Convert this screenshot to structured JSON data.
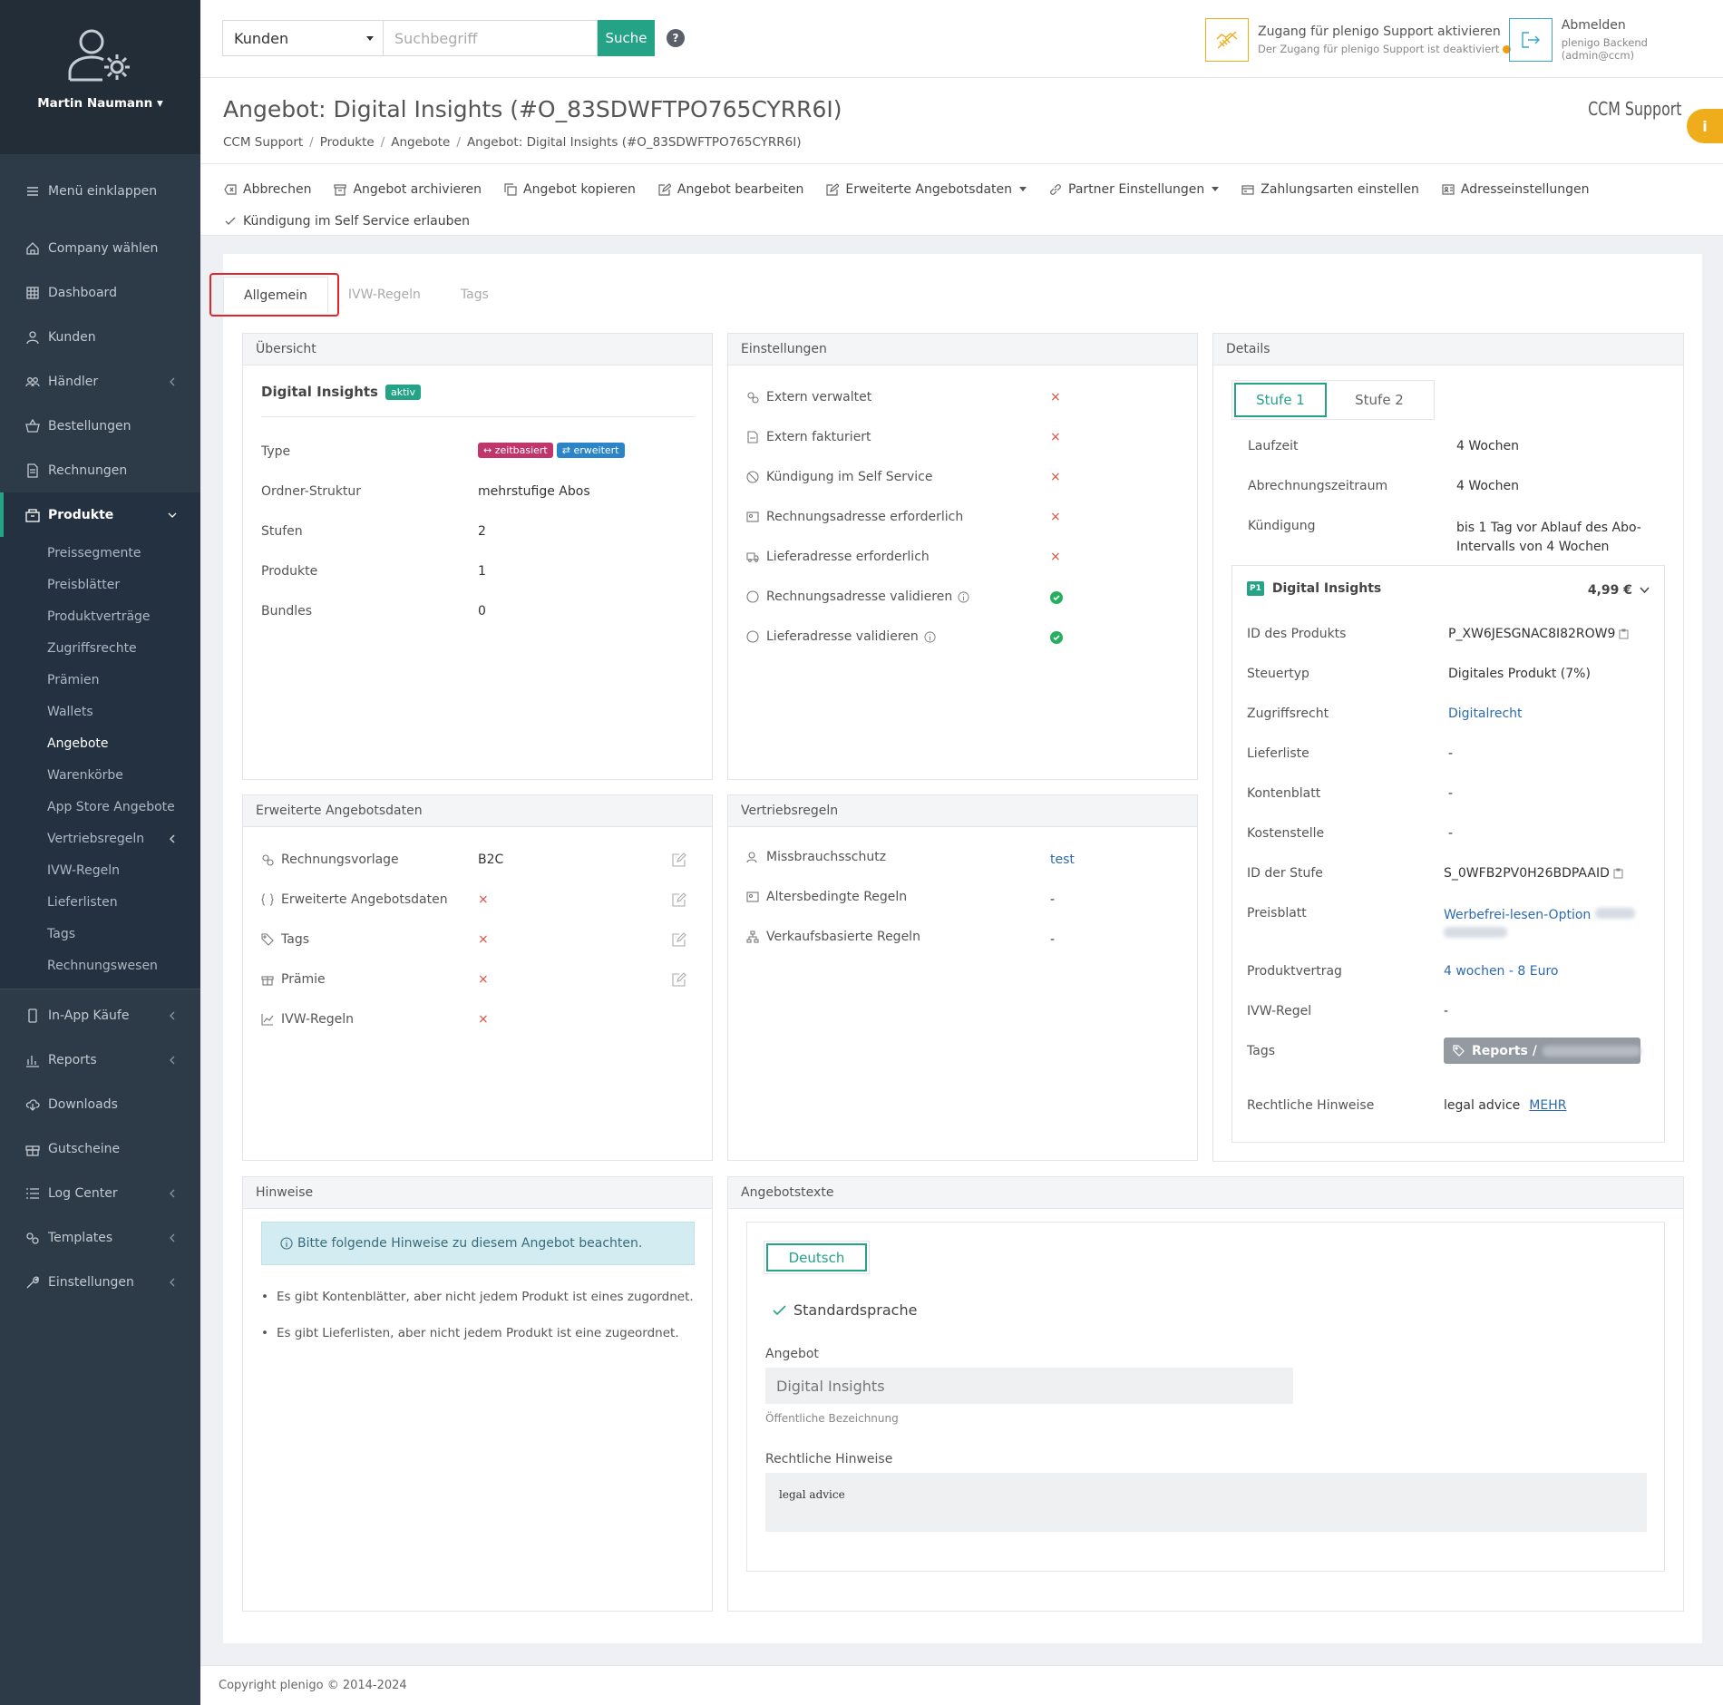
{
  "user": {
    "name": "Martin Naumann"
  },
  "sidebar": {
    "collapse": "Menü einklappen",
    "items": [
      {
        "label": "Company wählen"
      },
      {
        "label": "Dashboard"
      },
      {
        "label": "Kunden"
      },
      {
        "label": "Händler"
      },
      {
        "label": "Bestellungen"
      },
      {
        "label": "Rechnungen"
      },
      {
        "label": "Produkte"
      }
    ],
    "sub": [
      "Preissegmente",
      "Preisblätter",
      "Produktverträge",
      "Zugriffsrechte",
      "Prämien",
      "Wallets",
      "Angebote",
      "Warenkörbe",
      "App Store Angebote",
      "Vertriebsregeln",
      "IVW-Regeln",
      "Lieferlisten",
      "Tags",
      "Rechnungswesen"
    ],
    "items2": [
      {
        "label": "In-App Käufe"
      },
      {
        "label": "Reports"
      },
      {
        "label": "Downloads"
      },
      {
        "label": "Gutscheine"
      },
      {
        "label": "Log Center"
      },
      {
        "label": "Templates"
      },
      {
        "label": "Einstellungen"
      }
    ]
  },
  "topbar": {
    "select": "Kunden",
    "placeholder": "Suchbegriff",
    "search": "Suche",
    "help": "?",
    "support_title": "Zugang für plenigo Support aktivieren",
    "support_sub": "Der Zugang für plenigo Support ist deaktiviert",
    "logout_title": "Abmelden",
    "logout_sub": "plenigo Backend (admin@ccm)"
  },
  "header": {
    "title": "Angebot: Digital Insights (#O_83SDWFTPO765CYRR6I)",
    "breadcrumb": [
      "CCM Support",
      "Produkte",
      "Angebote",
      "Angebot: Digital Insights (#O_83SDWFTPO765CYRR6I)"
    ],
    "company": "CCM Support",
    "info": "i",
    "actions": [
      "Abbrechen",
      "Angebot archivieren",
      "Angebot kopieren",
      "Angebot bearbeiten",
      "Erweiterte Angebotsdaten",
      "Partner Einstellungen",
      "Zahlungsarten einstellen",
      "Adresseinstellungen",
      "Kündigung im Self Service erlauben"
    ]
  },
  "tabs": [
    "Allgemein",
    "IVW-Regeln",
    "Tags"
  ],
  "overview": {
    "title": "Übersicht",
    "name": "Digital Insights",
    "status": "aktiv",
    "type_label": "Type",
    "badge1": "zeitbasiert",
    "badge2": "erweitert",
    "rows": [
      {
        "label": "Ordner-Struktur",
        "value": "mehrstufige Abos"
      },
      {
        "label": "Stufen",
        "value": "2"
      },
      {
        "label": "Produkte",
        "value": "1"
      },
      {
        "label": "Bundles",
        "value": "0"
      }
    ]
  },
  "settings": {
    "title": "Einstellungen",
    "rows": [
      {
        "label": "Extern verwaltet",
        "value": "×"
      },
      {
        "label": "Extern fakturiert",
        "value": "×"
      },
      {
        "label": "Kündigung im Self Service",
        "value": "×"
      },
      {
        "label": "Rechnungsadresse erforderlich",
        "value": "×"
      },
      {
        "label": "Lieferadresse erforderlich",
        "value": "×"
      },
      {
        "label": "Rechnungsadresse validieren"
      },
      {
        "label": "Lieferadresse validieren"
      }
    ]
  },
  "details": {
    "title": "Details",
    "stufe1": "Stufe 1",
    "stufe2": "Stufe 2",
    "laufzeit_l": "Laufzeit",
    "laufzeit_v": "4 Wochen",
    "abr_l": "Abrechnungszeitraum",
    "abr_v": "4 Wochen",
    "kue_l": "Kündigung",
    "kue_v1": "bis 1 Tag vor Ablauf des Abo-",
    "kue_v2": "Intervalls von 4 Wochen",
    "product": {
      "tag": "P1",
      "name": "Digital Insights",
      "price": "4,99 €"
    },
    "rows": [
      {
        "label": "ID des Produkts",
        "value": "P_XW6JESGNAC8I82ROW9"
      },
      {
        "label": "Steuertyp",
        "value": "Digitales Produkt (7%)"
      },
      {
        "label": "Zugriffsrecht",
        "value": "Digitalrecht"
      },
      {
        "label": "Lieferliste",
        "value": "-"
      },
      {
        "label": "Kontenblatt",
        "value": "-"
      },
      {
        "label": "Kostenstelle",
        "value": "-"
      },
      {
        "label": "ID der Stufe",
        "value": "S_0WFB2PV0H26BDPAAID"
      },
      {
        "label": "Preisblatt",
        "value": "Werbefrei-lesen-Option"
      },
      {
        "label": "Produktvertrag",
        "value": "4 wochen - 8 Euro"
      },
      {
        "label": "IVW-Regel",
        "value": "-"
      },
      {
        "label": "Tags",
        "value": "Reports /"
      },
      {
        "label": "Rechtliche Hinweise",
        "value": "legal advice",
        "more": "MEHR"
      }
    ]
  },
  "extended": {
    "title": "Erweiterte Angebotsdaten",
    "rows": [
      {
        "label": "Rechnungsvorlage",
        "value": "B2C"
      },
      {
        "label": "Erweiterte Angebotsdaten",
        "value": "×"
      },
      {
        "label": "Tags",
        "value": "×"
      },
      {
        "label": "Prämie",
        "value": "×"
      },
      {
        "label": "IVW-Regeln",
        "value": "×"
      }
    ]
  },
  "rules": {
    "title": "Vertriebsregeln",
    "rows": [
      {
        "label": "Missbrauchsschutz",
        "value": "test"
      },
      {
        "label": "Altersbedingte Regeln",
        "value": "-"
      },
      {
        "label": "Verkaufsbasierte Regeln",
        "value": "-"
      }
    ]
  },
  "notes": {
    "title": "Hinweise",
    "alert": "Bitte folgende Hinweise zu diesem Angebot beachten.",
    "items": [
      "Es gibt Kontenblätter, aber nicht jedem Produkt ist eines zugordnet.",
      "Es gibt Lieferlisten, aber nicht jedem Produkt ist eine zugeordnet."
    ]
  },
  "texts": {
    "title": "Angebotstexte",
    "lang": "Deutsch",
    "default": "Standardsprache",
    "offer_label": "Angebot",
    "offer_value": "Digital Insights",
    "offer_help": "Öffentliche Bezeichnung",
    "legal_label": "Rechtliche Hinweise",
    "legal_value": "legal advice"
  },
  "footer": "Copyright plenigo © 2014-2024",
  "colors": {
    "accent": "#24a387",
    "sidebar": "#2d3a48",
    "danger": "#e74c3c",
    "warning": "#f0ad1b",
    "link": "#2c6ab1"
  }
}
